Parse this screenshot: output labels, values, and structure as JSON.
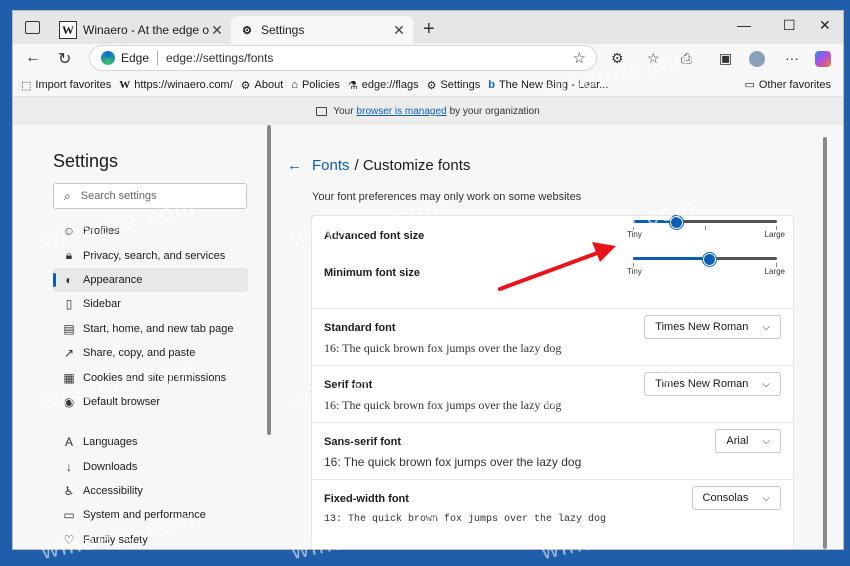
{
  "tabs": [
    {
      "label": "Winaero - At the edge of tweakin",
      "icon": "winaero-w-icon"
    },
    {
      "label": "Settings",
      "icon": "gear-icon"
    }
  ],
  "address": {
    "site": "Edge",
    "url": "edge://settings/fonts"
  },
  "favorites": {
    "items": [
      {
        "label": "Import favorites",
        "icon": "import-icon"
      },
      {
        "label": "https://winaero.com/",
        "icon": "winaero-w-icon"
      },
      {
        "label": "About",
        "icon": "gear-icon"
      },
      {
        "label": "Policies",
        "icon": "briefcase-icon"
      },
      {
        "label": "edge://flags",
        "icon": "flask-icon"
      },
      {
        "label": "Settings",
        "icon": "gear-icon"
      },
      {
        "label": "The New Bing - Lear...",
        "icon": "bing-icon"
      }
    ],
    "other": "Other favorites"
  },
  "managed": {
    "prefix": "Your",
    "link": "browser is managed",
    "suffix": "by your organization"
  },
  "sidebar": {
    "title": "Settings",
    "search_placeholder": "Search settings",
    "items": [
      {
        "label": "Profiles",
        "icon": "profile-icon"
      },
      {
        "label": "Privacy, search, and services",
        "icon": "lock-icon"
      },
      {
        "label": "Appearance",
        "icon": "palette-icon",
        "active": true
      },
      {
        "label": "Sidebar",
        "icon": "sidebar-icon"
      },
      {
        "label": "Start, home, and new tab page",
        "icon": "home-icon"
      },
      {
        "label": "Share, copy, and paste",
        "icon": "share-icon"
      },
      {
        "label": "Cookies and site permissions",
        "icon": "cookie-icon"
      },
      {
        "label": "Default browser",
        "icon": "browser-icon"
      },
      {
        "label": "Languages",
        "icon": "language-icon"
      },
      {
        "label": "Downloads",
        "icon": "download-icon"
      },
      {
        "label": "Accessibility",
        "icon": "accessibility-icon"
      },
      {
        "label": "System and performance",
        "icon": "system-icon"
      },
      {
        "label": "Family safety",
        "icon": "family-icon"
      }
    ]
  },
  "main": {
    "breadcrumb_link": "Fonts",
    "breadcrumb_rest": "/ Customize fonts",
    "note": "Your font preferences may only work on some websites",
    "advanced_label": "Advanced font size",
    "advanced_value": 0.3,
    "minimum_label": "Minimum font size",
    "minimum_value": 0.53,
    "slider_min": "Tiny",
    "slider_max": "Large",
    "fonts": [
      {
        "label": "Standard font",
        "value": "Times New Roman",
        "sample": "16: The quick brown fox jumps over the lazy dog",
        "style": "serif"
      },
      {
        "label": "Serif font",
        "value": "Times New Roman",
        "sample": "16: The quick brown fox jumps over the lazy dog",
        "style": "serif"
      },
      {
        "label": "Sans-serif font",
        "value": "Arial",
        "sample": "16: The quick brown fox jumps over the lazy dog",
        "style": "sans"
      },
      {
        "label": "Fixed-width font",
        "value": "Consolas",
        "sample": "13: The quick brown fox jumps over the lazy dog",
        "style": "mono"
      }
    ]
  },
  "watermark": "winaero.com",
  "colors": {
    "accent": "#0a5fb4",
    "arrow": "#e8141b",
    "desktop": "#1f5ea8"
  }
}
